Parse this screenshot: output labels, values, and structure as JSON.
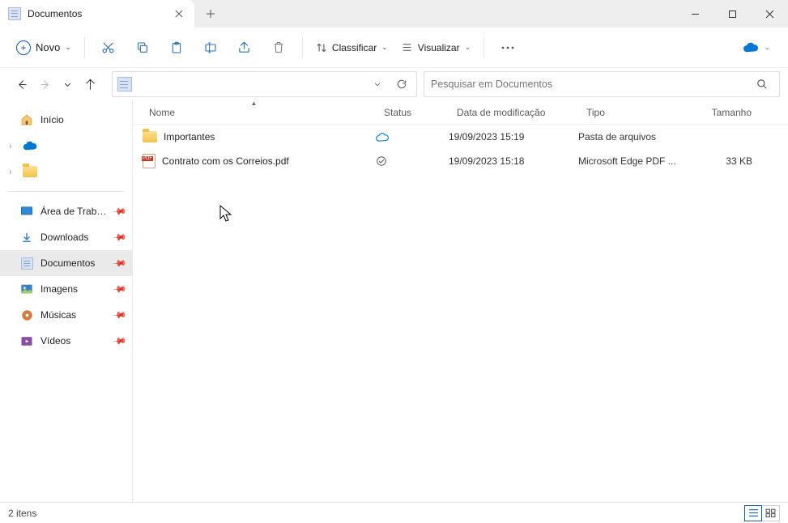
{
  "tab": {
    "title": "Documentos"
  },
  "toolbar": {
    "new_label": "Novo",
    "sort_label": "Classificar",
    "view_label": "Visualizar"
  },
  "search": {
    "placeholder": "Pesquisar em Documentos"
  },
  "nav": {
    "home": "Início",
    "desktop": "Área de Trabalho",
    "downloads": "Downloads",
    "documents": "Documentos",
    "pictures": "Imagens",
    "music": "Músicas",
    "videos": "Vídeos"
  },
  "columns": {
    "name": "Nome",
    "status": "Status",
    "date": "Data de modificação",
    "type": "Tipo",
    "size": "Tamanho"
  },
  "rows": [
    {
      "name": "Importantes",
      "icon": "folder",
      "status": "cloud",
      "date": "19/09/2023 15:19",
      "type": "Pasta de arquivos",
      "size": ""
    },
    {
      "name": "Contrato com os Correios.pdf",
      "icon": "pdf",
      "status": "synced",
      "date": "19/09/2023 15:18",
      "type": "Microsoft Edge PDF ...",
      "size": "33 KB"
    }
  ],
  "status": {
    "count": "2 itens"
  }
}
